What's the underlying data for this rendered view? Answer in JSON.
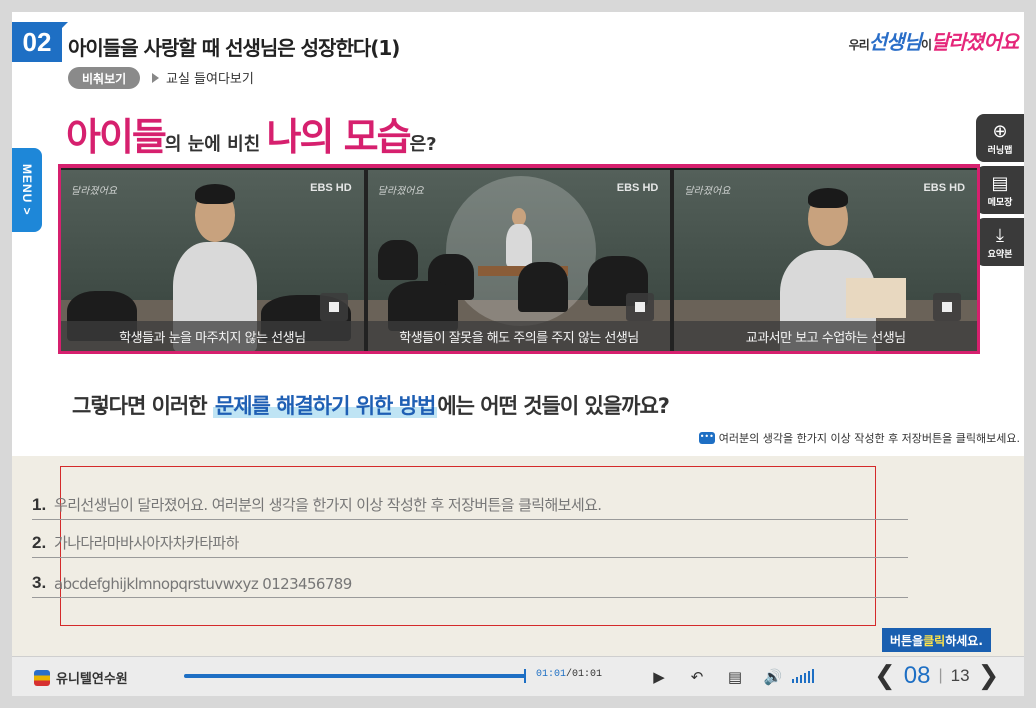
{
  "header": {
    "chapter_number": "02",
    "lesson_title": "아이들을 사랑할 때 선생님은 성장한다(1)",
    "section_tag": "비춰보기",
    "sub_title": "교실 들여다보기",
    "brand": {
      "pre": "우리",
      "mid": "선생님",
      "post": "이",
      "tail": "달라졌어요"
    }
  },
  "side_menu": {
    "menu_label": "MENU >",
    "buttons": [
      {
        "label": "러닝맵",
        "icon": "compass-icon"
      },
      {
        "label": "메모장",
        "icon": "memo-icon"
      },
      {
        "label": "요약본",
        "icon": "download-icon"
      }
    ]
  },
  "headline": {
    "part1": "아이들",
    "part2": "의 눈에 비친 ",
    "part3": "나의 모습",
    "part4": "은?"
  },
  "videos": [
    {
      "caption": "학생들과 눈을 마주치지 않는 선생님",
      "badge": "EBS HD"
    },
    {
      "caption": "학생들이 잘못을 해도 주의를 주지 않는 선생님",
      "badge": "EBS HD"
    },
    {
      "caption": "교과서만 보고 수업하는 선생님",
      "badge": "EBS HD"
    }
  ],
  "question": {
    "part1": "그렇다면 이러한 ",
    "highlight": "문제를 해결하기 위한 방법",
    "part2": "에는 어떤 것들이 있을까요?"
  },
  "instruction": "여러분의 생각을 한가지 이상 작성한 후 저장버튼을 클릭해보세요.",
  "answers": [
    {
      "num": "1.",
      "text": "우리선생님이 달라졌어요. 여러분의 생각을 한가지 이상 작성한 후 저장버튼을 클릭해보세요."
    },
    {
      "num": "2.",
      "text": "가나다라마바사아자차카타파하"
    },
    {
      "num": "3.",
      "text": "abcdefghijklmnopqrstuvwxyz 0123456789"
    }
  ],
  "hint": {
    "pre": "버튼을 ",
    "strong": "클릭",
    "post": "하세요."
  },
  "controls": {
    "org_name": "유니텔연수원",
    "time_current": "01:01",
    "time_sep": "/",
    "time_total": "01:01",
    "progress": 1.0,
    "play": "▶",
    "replay": "↶",
    "script": "▤",
    "volume": "🔊",
    "page_current": "08",
    "page_sep": "|",
    "page_total": "13",
    "prev": "❮",
    "next": "❯"
  }
}
